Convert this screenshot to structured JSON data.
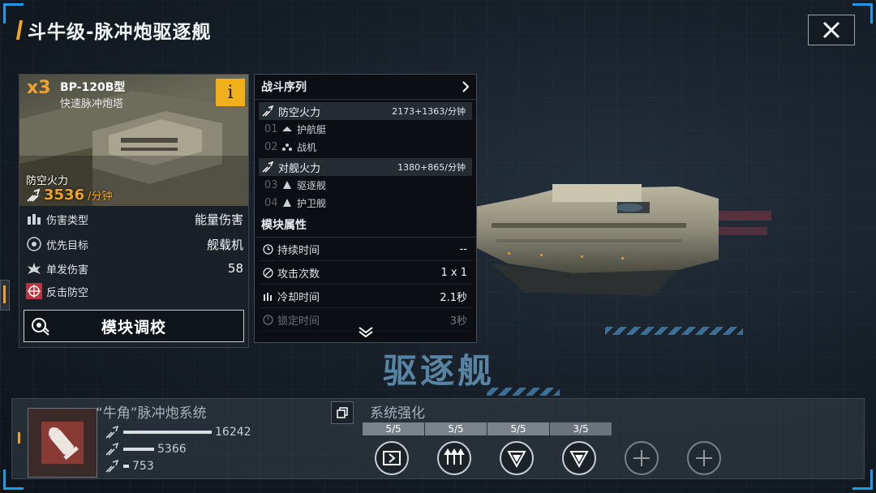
{
  "header": {
    "title": "斗牛级-脉冲炮驱逐舰"
  },
  "ship_class": "驱逐舰",
  "weapon": {
    "count": "x3",
    "name": "BP-120B型",
    "subtitle": "快速脉冲炮塔",
    "info_label": "i",
    "aa_label": "防空火力",
    "aa_value": "3536",
    "aa_unit": "/分钟",
    "stats": [
      {
        "label": "伤害类型",
        "value": "能量伤害"
      },
      {
        "label": "优先目标",
        "value": "舰载机"
      },
      {
        "label": "单发伤害",
        "value": "58"
      },
      {
        "label": "反击防空",
        "value": ""
      }
    ],
    "tune_button": "模块调校"
  },
  "combat": {
    "header": "战斗序列",
    "sections": [
      {
        "label": "防空火力",
        "value": "2173+1363/分钟",
        "targets": [
          {
            "num": "01",
            "label": "护航艇"
          },
          {
            "num": "02",
            "label": "战机"
          }
        ]
      },
      {
        "label": "对舰火力",
        "value": "1380+865/分钟",
        "targets": [
          {
            "num": "03",
            "label": "驱逐舰"
          },
          {
            "num": "04",
            "label": "护卫舰"
          }
        ]
      }
    ],
    "module_header": "模块属性",
    "attrs": [
      {
        "label": "持续时间",
        "value": "--"
      },
      {
        "label": "攻击次数",
        "value": "1 x 1"
      },
      {
        "label": "冷却时间",
        "value": "2.1秒"
      },
      {
        "label": "锁定时间",
        "value": "3秒"
      }
    ]
  },
  "system": {
    "title": "“牛角”脉冲炮系统",
    "enhance_title": "系统强化",
    "bars": [
      {
        "value": "16242",
        "fraction": 0.78
      },
      {
        "value": "5366",
        "fraction": 0.27
      },
      {
        "value": "753",
        "fraction": 0.05
      }
    ],
    "slots": [
      {
        "level": "5/5",
        "state": "full"
      },
      {
        "level": "5/5",
        "state": "full"
      },
      {
        "level": "5/5",
        "state": "full"
      },
      {
        "level": "3/5",
        "state": "partial"
      },
      {
        "level": "",
        "state": "locked"
      },
      {
        "level": "",
        "state": "locked"
      }
    ]
  },
  "colors": {
    "accent": "#f0a22a",
    "frame": "#1e9be6",
    "info_button": "#f0b01c"
  }
}
